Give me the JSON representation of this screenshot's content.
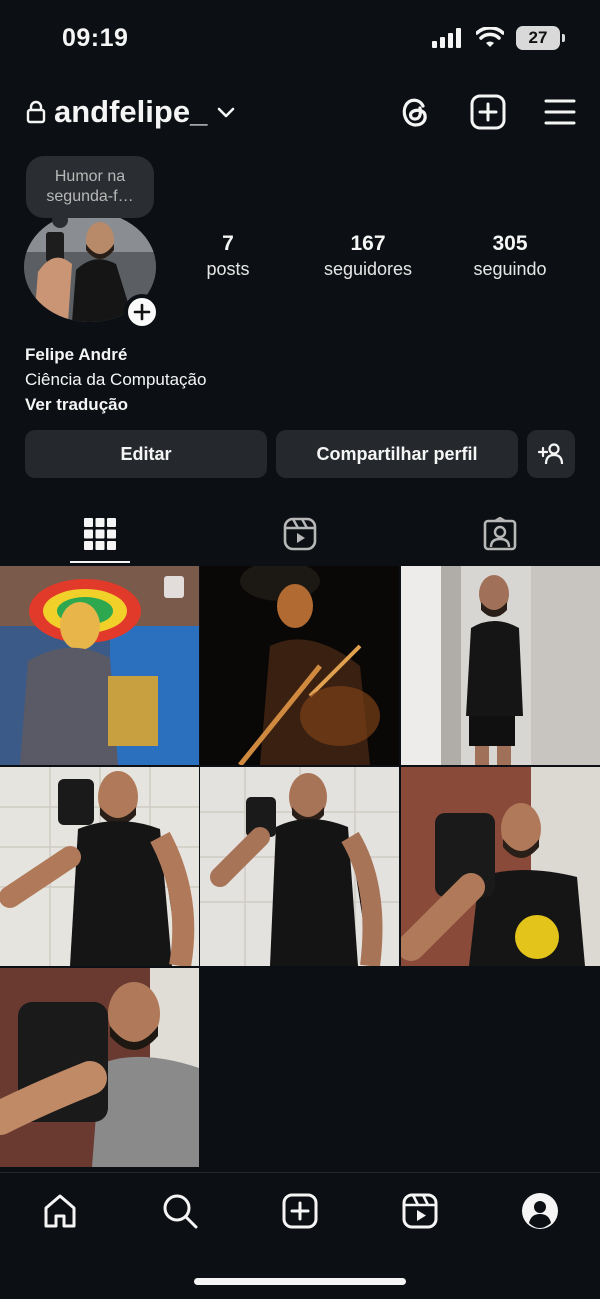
{
  "status_bar": {
    "time": "09:19",
    "battery": "27"
  },
  "header": {
    "username": "andfelipe_"
  },
  "profile": {
    "note": "Humor na segunda-f…",
    "stats": [
      {
        "value": "7",
        "label": "posts"
      },
      {
        "value": "167",
        "label": "seguidores"
      },
      {
        "value": "305",
        "label": "seguindo"
      }
    ],
    "name": "Felipe André",
    "bio": "Ciência da Computação",
    "translate_link": "Ver tradução"
  },
  "actions": {
    "edit": "Editar",
    "share": "Compartilhar perfil"
  },
  "tabs": [
    "grid-icon",
    "reels-icon",
    "tagged-icon"
  ],
  "colors": {
    "background": "#0c1014",
    "button": "#25292e",
    "text": "#f5f5f5"
  },
  "nav": [
    "home-icon",
    "search-icon",
    "create-icon",
    "reels-icon",
    "profile-icon"
  ]
}
